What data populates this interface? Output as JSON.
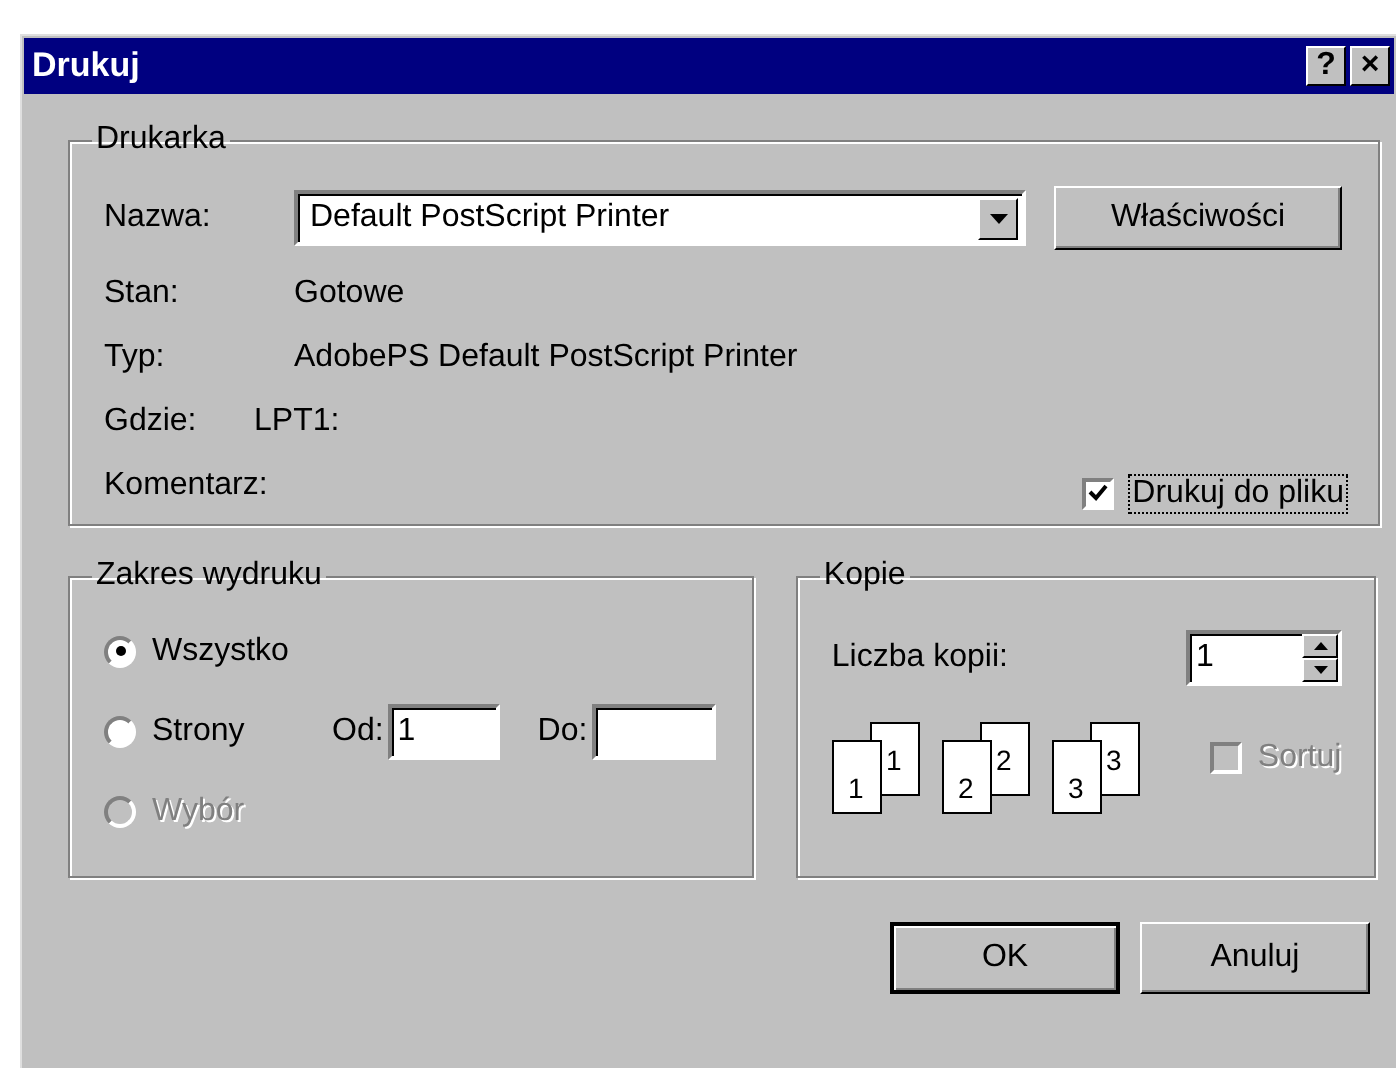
{
  "window": {
    "title": "Drukuj",
    "title_buttons": [
      "?",
      "×"
    ]
  },
  "printer": {
    "legend": "Drukarka",
    "name_label": "Nazwa:",
    "name_value": "Default PostScript Printer",
    "properties_button": "Właściwości",
    "info": [
      {
        "label": "Stan:",
        "value": "Gotowe"
      },
      {
        "label": "Typ:",
        "value": "AdobePS Default PostScript Printer"
      },
      {
        "label": "Gdzie:",
        "value": "LPT1:"
      },
      {
        "label": "Komentarz:"
      }
    ],
    "print_to_file": {
      "label": "Drukuj do pliku",
      "checked": true
    }
  },
  "range": {
    "legend": "Zakres wydruku",
    "options": [
      {
        "label": "Wszystko",
        "selected": true,
        "disabled": false
      },
      {
        "label": "Strony",
        "selected": false,
        "disabled": false
      },
      {
        "label": "Wybór",
        "selected": false,
        "disabled": true
      }
    ],
    "from_label": "Od:",
    "from_value": "1",
    "to_label": "Do:"
  },
  "copies": {
    "legend": "Kopie",
    "count_label": "Liczba kopii:",
    "count_value": "1",
    "collate_icons": [
      {
        "front": "1",
        "back": "1"
      },
      {
        "front": "2",
        "back": "2"
      },
      {
        "front": "3",
        "back": "3"
      }
    ],
    "collate": {
      "label": "Sortuj",
      "checked": false,
      "disabled": true
    }
  },
  "buttons": [
    {
      "label": "OK",
      "default": true
    },
    {
      "label": "Anuluj",
      "default": false
    }
  ]
}
